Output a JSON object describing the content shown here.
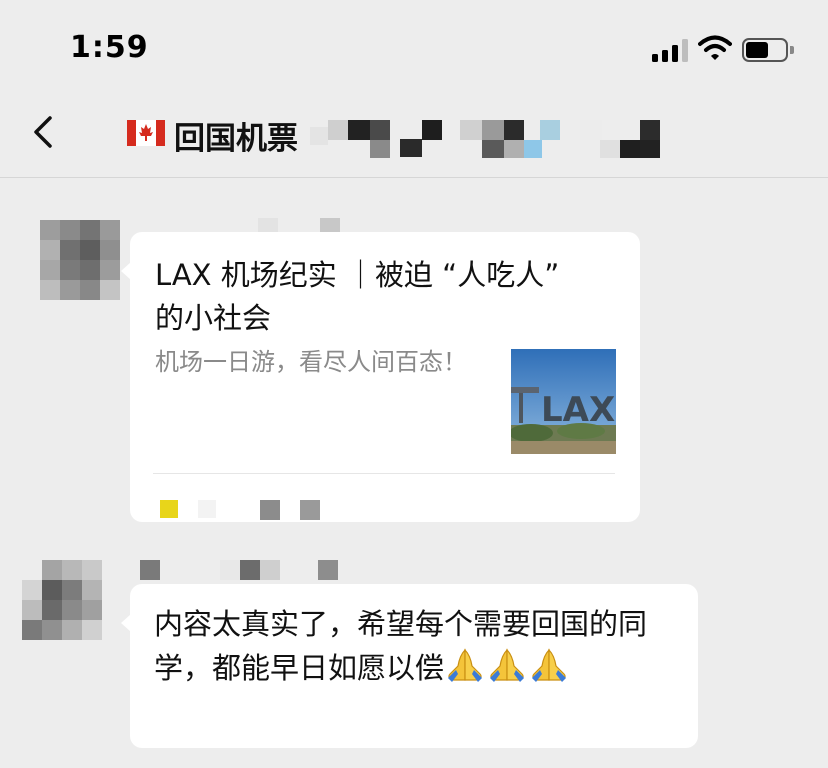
{
  "status_bar": {
    "time": "1:59"
  },
  "nav": {
    "flag_icon": "canada-flag-icon",
    "title": "回国机票"
  },
  "messages": [
    {
      "type": "link_card",
      "card": {
        "title": "LAX 机场纪实 ｜被迫 “人吃人” 的小社会",
        "description": "机场一日游，看尽人间百态！",
        "thumbnail": "LAX"
      }
    },
    {
      "type": "text",
      "text": "内容太真实了，希望每个需要回国的同学，都能早日如愿以偿",
      "emoji": "folded-hands-icon",
      "emoji_count": 3
    }
  ],
  "colors": {
    "background": "#ededed",
    "bubble": "#ffffff",
    "text": "#111111",
    "secondary_text": "#8a8a8a",
    "source_badge": "#e8d51a"
  }
}
